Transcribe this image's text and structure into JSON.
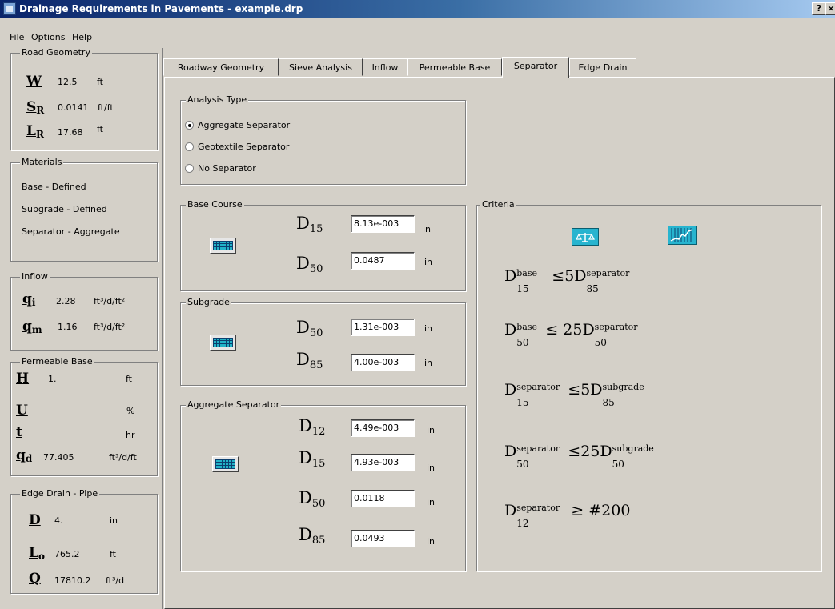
{
  "window": {
    "title": "Drainage Requirements in Pavements - example.drp",
    "help_btn": "?",
    "close_btn": "×"
  },
  "menu": [
    "File",
    "Options",
    "Help"
  ],
  "left": {
    "road_geometry": {
      "title": "Road Geometry",
      "rows": [
        {
          "sym": "W",
          "sub": "",
          "value": "12.5",
          "unit": "ft"
        },
        {
          "sym": "S",
          "sub": "R",
          "value": "0.0141",
          "unit": "ft/ft"
        },
        {
          "sym": "L",
          "sub": "R",
          "value": "17.68",
          "unit": "ft"
        }
      ]
    },
    "materials": {
      "title": "Materials",
      "lines": [
        "Base - Defined",
        "Subgrade - Defined",
        "Separator - Aggregate"
      ]
    },
    "inflow": {
      "title": "Inflow",
      "rows": [
        {
          "sym": "q",
          "sub": "i",
          "value": "2.28",
          "unit": "ft³/d/ft²"
        },
        {
          "sym": "q",
          "sub": "m",
          "value": "1.16",
          "unit": "ft³/d/ft²"
        }
      ]
    },
    "permeable_base": {
      "title": "Permeable Base",
      "rows": [
        {
          "sym": "H",
          "sub": "",
          "value": "1.",
          "unit": "ft"
        },
        {
          "sym": "U",
          "sub": "",
          "value": "",
          "unit": "%"
        },
        {
          "sym": "t",
          "sub": "",
          "value": "",
          "unit": "hr"
        },
        {
          "sym": "q",
          "sub": "d",
          "value": "77.405",
          "unit": "ft³/d/ft"
        }
      ]
    },
    "edge_drain": {
      "title": "Edge Drain - Pipe",
      "rows": [
        {
          "sym": "D",
          "sub": "",
          "value": "4.",
          "unit": "in"
        },
        {
          "sym": "L",
          "sub": "o",
          "value": "765.2",
          "unit": "ft"
        },
        {
          "sym": "Q",
          "sub": "",
          "value": "17810.2",
          "unit": "ft³/d"
        }
      ]
    }
  },
  "tabs": [
    "Roadway Geometry",
    "Sieve Analysis",
    "Inflow",
    "Permeable Base",
    "Separator",
    "Edge Drain"
  ],
  "active_tab": "Separator",
  "analysis": {
    "title": "Analysis Type",
    "options": [
      "Aggregate Separator",
      "Geotextile Separator",
      "No Separator"
    ],
    "selected": "Aggregate Separator"
  },
  "base_course": {
    "title": "Base Course",
    "rows": [
      {
        "label": "D",
        "sub": "15",
        "value": "8.13e-003",
        "unit": "in"
      },
      {
        "label": "D",
        "sub": "50",
        "value": "0.0487",
        "unit": "in"
      }
    ]
  },
  "subgrade": {
    "title": "Subgrade",
    "rows": [
      {
        "label": "D",
        "sub": "50",
        "value": "1.31e-003",
        "unit": "in"
      },
      {
        "label": "D",
        "sub": "85",
        "value": "4.00e-003",
        "unit": "in"
      }
    ]
  },
  "aggregate_separator": {
    "title": "Aggregate Separator",
    "rows": [
      {
        "label": "D",
        "sub": "12",
        "value": "4.49e-003",
        "unit": "in"
      },
      {
        "label": "D",
        "sub": "15",
        "value": "4.93e-003",
        "unit": "in"
      },
      {
        "label": "D",
        "sub": "50",
        "value": "0.0118",
        "unit": "in"
      },
      {
        "label": "D",
        "sub": "85",
        "value": "0.0493",
        "unit": "in"
      }
    ]
  },
  "criteria": {
    "title": "Criteria",
    "rules": [
      {
        "l_sup": "base",
        "l_sub": "15",
        "op": "≤",
        "coef": "5",
        "r_sup": "separator",
        "r_sub": "85"
      },
      {
        "l_sup": "base",
        "l_sub": "50",
        "op": "≤",
        "coef": "25",
        "r_sup": "separator",
        "r_sub": "50"
      },
      {
        "l_sup": "separator",
        "l_sub": "15",
        "op": "≤",
        "coef": "5",
        "r_sup": "subgrade",
        "r_sub": "85"
      },
      {
        "l_sup": "separator",
        "l_sub": "50",
        "op": "≤",
        "coef": "25",
        "r_sup": "subgrade",
        "r_sub": "50"
      },
      {
        "l_sup": "separator",
        "l_sub": "12",
        "op": "≥",
        "coef": "#200",
        "r_sup": "",
        "r_sub": ""
      }
    ],
    "symbol": "D"
  },
  "colors": {
    "accent": "#27b4cf",
    "title_start": "#0a246a",
    "title_end": "#a6caf0"
  }
}
